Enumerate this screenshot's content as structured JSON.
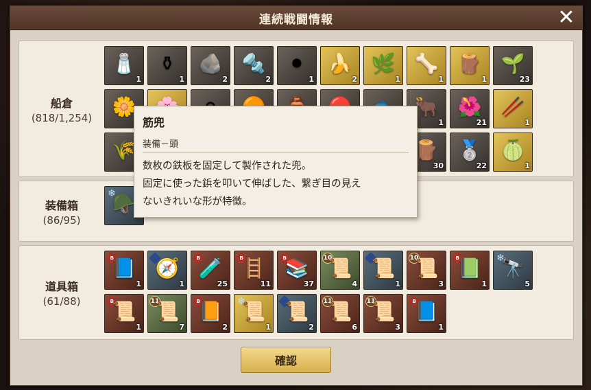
{
  "dialog": {
    "title": "連続戦闘情報",
    "close_label": "✕",
    "confirm_label": "確認"
  },
  "cargo": {
    "name": "船倉",
    "count": "(818/1,254)",
    "items": [
      {
        "icon": "🧂",
        "qty": "1",
        "color": "dark"
      },
      {
        "icon": "⚱",
        "qty": "1",
        "color": "dark"
      },
      {
        "icon": "🪨",
        "qty": "2",
        "color": "dark"
      },
      {
        "icon": "🔩",
        "qty": "2",
        "color": "dark"
      },
      {
        "icon": "⚫",
        "qty": "1",
        "color": "dark"
      },
      {
        "icon": "🍌",
        "qty": "2",
        "color": "gold"
      },
      {
        "icon": "🌿",
        "qty": "1",
        "color": "gold"
      },
      {
        "icon": "🦴",
        "qty": "1",
        "color": "gold"
      },
      {
        "icon": "🪵",
        "qty": "1",
        "color": "gold"
      },
      {
        "icon": "🌱",
        "qty": "23",
        "color": "dark"
      },
      {
        "icon": "🌼",
        "qty": "",
        "color": "dark"
      },
      {
        "icon": "🌸",
        "qty": "",
        "color": "gold"
      },
      {
        "icon": "⚪",
        "qty": "",
        "color": "dark"
      },
      {
        "icon": "🟠",
        "qty": "",
        "color": "dark"
      },
      {
        "icon": "🏺",
        "qty": "",
        "color": "dark"
      },
      {
        "icon": "🔴",
        "qty": "",
        "color": "dark"
      },
      {
        "icon": "🐟",
        "qty": "",
        "color": "dark"
      },
      {
        "icon": "🐂",
        "qty": "1",
        "color": "dark"
      },
      {
        "icon": "🌺",
        "qty": "21",
        "color": "dark"
      },
      {
        "icon": "🥢",
        "qty": "1",
        "color": "gold"
      },
      {
        "icon": "🌾",
        "qty": "1",
        "color": "dark"
      },
      {
        "icon": "",
        "qty": "",
        "color": "dark"
      },
      {
        "icon": "",
        "qty": "",
        "color": "dark"
      },
      {
        "icon": "",
        "qty": "",
        "color": "dark"
      },
      {
        "icon": "",
        "qty": "",
        "color": "dark"
      },
      {
        "icon": "",
        "qty": "",
        "color": "dark"
      },
      {
        "icon": "",
        "qty": "",
        "color": "dark"
      },
      {
        "icon": "🪵",
        "qty": "30",
        "color": "dark"
      },
      {
        "icon": "🥈",
        "qty": "22",
        "color": "dark"
      },
      {
        "icon": "🍈",
        "qty": "1",
        "color": "gold"
      }
    ]
  },
  "equipment": {
    "name": "装備箱",
    "count": "(86/95)",
    "items": [
      {
        "icon": "🪖",
        "qty": "",
        "color": "blue",
        "badge": "ice",
        "badge_text": "❄"
      }
    ]
  },
  "tools": {
    "name": "道具箱",
    "count": "(61/88)",
    "items": [
      {
        "icon": "📘",
        "qty": "1",
        "color": "brown",
        "badge": "b",
        "badge_text": "B"
      },
      {
        "icon": "🧭",
        "qty": "1",
        "color": "blue",
        "badge": "blue",
        "badge_text": ""
      },
      {
        "icon": "🧪",
        "qty": "25",
        "color": "brown",
        "badge": "b",
        "badge_text": "B"
      },
      {
        "icon": "🪜",
        "qty": "11",
        "color": "brown",
        "badge": "b",
        "badge_text": "B"
      },
      {
        "icon": "📚",
        "qty": "37",
        "color": "brown",
        "badge": "b",
        "badge_text": "B"
      },
      {
        "icon": "📜",
        "qty": "4",
        "color": "green",
        "badge": "lv",
        "badge_text": "10"
      },
      {
        "icon": "📜",
        "qty": "1",
        "color": "blue",
        "badge": "blue",
        "badge_text": ""
      },
      {
        "icon": "📜",
        "qty": "3",
        "color": "brown",
        "badge": "lv",
        "badge_text": "10"
      },
      {
        "icon": "📗",
        "qty": "1",
        "color": "brown",
        "badge": "b",
        "badge_text": "B"
      },
      {
        "icon": "🔭",
        "qty": "5",
        "color": "blue",
        "badge": "ice",
        "badge_text": "❄"
      },
      {
        "icon": "📜",
        "qty": "1",
        "color": "brown",
        "badge": "b",
        "badge_text": "B"
      },
      {
        "icon": "📜",
        "qty": "7",
        "color": "green",
        "badge": "lv",
        "badge_text": "11"
      },
      {
        "icon": "📙",
        "qty": "2",
        "color": "brown",
        "badge": "b",
        "badge_text": "B"
      },
      {
        "icon": "📜",
        "qty": "1",
        "color": "gold",
        "badge": "ice",
        "badge_text": "❄"
      },
      {
        "icon": "📜",
        "qty": "2",
        "color": "blue",
        "badge": "blue",
        "badge_text": ""
      },
      {
        "icon": "📜",
        "qty": "6",
        "color": "brown",
        "badge": "lv",
        "badge_text": "11"
      },
      {
        "icon": "📜",
        "qty": "3",
        "color": "brown",
        "badge": "lv",
        "badge_text": "11"
      },
      {
        "icon": "📘",
        "qty": "1",
        "color": "brown",
        "badge": "b",
        "badge_text": "B"
      }
    ]
  },
  "tooltip": {
    "name": "筋兜",
    "category": "装備－頭",
    "desc_line1": "数枚の鉄板を固定して製作された兜。",
    "desc_line2": "固定に使った鋲を叩いて伸ばした、繋ぎ目の見え",
    "desc_line3": "ないきれいな形が特徴。"
  }
}
